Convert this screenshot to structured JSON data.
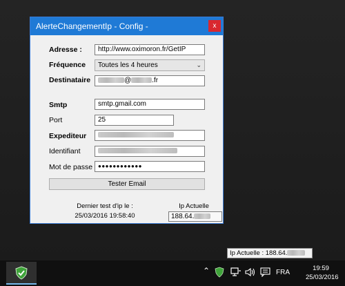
{
  "window": {
    "title": "AlerteChangementIp - Config -",
    "close": "x"
  },
  "form": {
    "adresse_label": "Adresse :",
    "adresse_value": "http://www.oximoron.fr/GetIP",
    "frequence_label": "Fréquence",
    "frequence_value": "Toutes les 4 heures",
    "destinataire_label": "Destinataire",
    "destinataire_at": "@",
    "destinataire_tld": ".fr",
    "smtp_label": "Smtp",
    "smtp_value": "smtp.gmail.com",
    "port_label": "Port",
    "port_value": "25",
    "expediteur_label": "Expediteur",
    "identifiant_label": "Identifiant",
    "password_label": "Mot de passe",
    "password_value": "●●●●●●●●●●●●",
    "test_button": "Tester Email"
  },
  "status": {
    "last_test_label": "Dernier test d'ip le :",
    "last_test_value": "25/03/2016 19:58:40",
    "ip_label": "Ip Actuelle",
    "ip_value": "188.64."
  },
  "tooltip": {
    "text": "Ip Actuelle : 188.64."
  },
  "taskbar": {
    "language": "FRA",
    "time": "19:59",
    "date": "25/03/2016",
    "icons": [
      "chevron-up-icon",
      "shield-icon",
      "network-icon",
      "volume-icon",
      "notification-icon"
    ]
  }
}
